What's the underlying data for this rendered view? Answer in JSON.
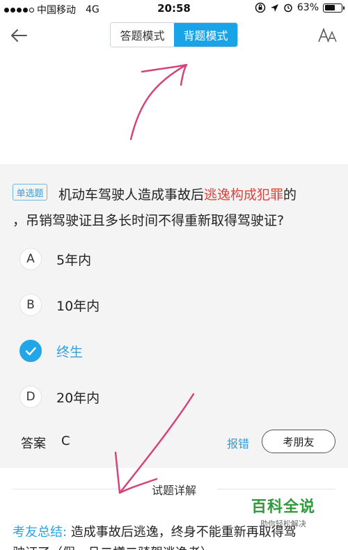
{
  "status_bar": {
    "carrier": "中国移动",
    "network": "4G",
    "time": "20:58",
    "battery": "63%",
    "battery_level": 0.63
  },
  "nav": {
    "mode_answer": "答题模式",
    "mode_recite": "背题模式",
    "active_mode": "背题模式"
  },
  "question": {
    "type_tag": "单选题",
    "text_part1": "机动车驾驶人造成事故后",
    "text_highlight": "逃逸构成犯罪",
    "text_part2": "的",
    "text_line2": "，吊销驾驶证且多长时间不得重新取得驾驶证?",
    "options": [
      {
        "letter": "A",
        "text": "5年内"
      },
      {
        "letter": "B",
        "text": "10年内"
      },
      {
        "letter": "C",
        "text": "终生",
        "selected": true
      },
      {
        "letter": "D",
        "text": "20年内"
      }
    ]
  },
  "answer": {
    "label": "答案",
    "value": "C",
    "report": "报错",
    "ask_friends": "考朋友"
  },
  "detail": {
    "title": "试题详解",
    "summary_label": "考友总结:",
    "summary_text": "造成事故后逃逸，终身不能重新再取得驾",
    "summary_line2": "驶证了（假，且二樽二骑驾逃逸者）"
  },
  "watermark": {
    "title": "百科全说",
    "subtitle": "助你轻松解决"
  },
  "colors": {
    "accent": "#1aa4e8",
    "highlight": "#e0403a",
    "annotation": "#d4437a"
  }
}
